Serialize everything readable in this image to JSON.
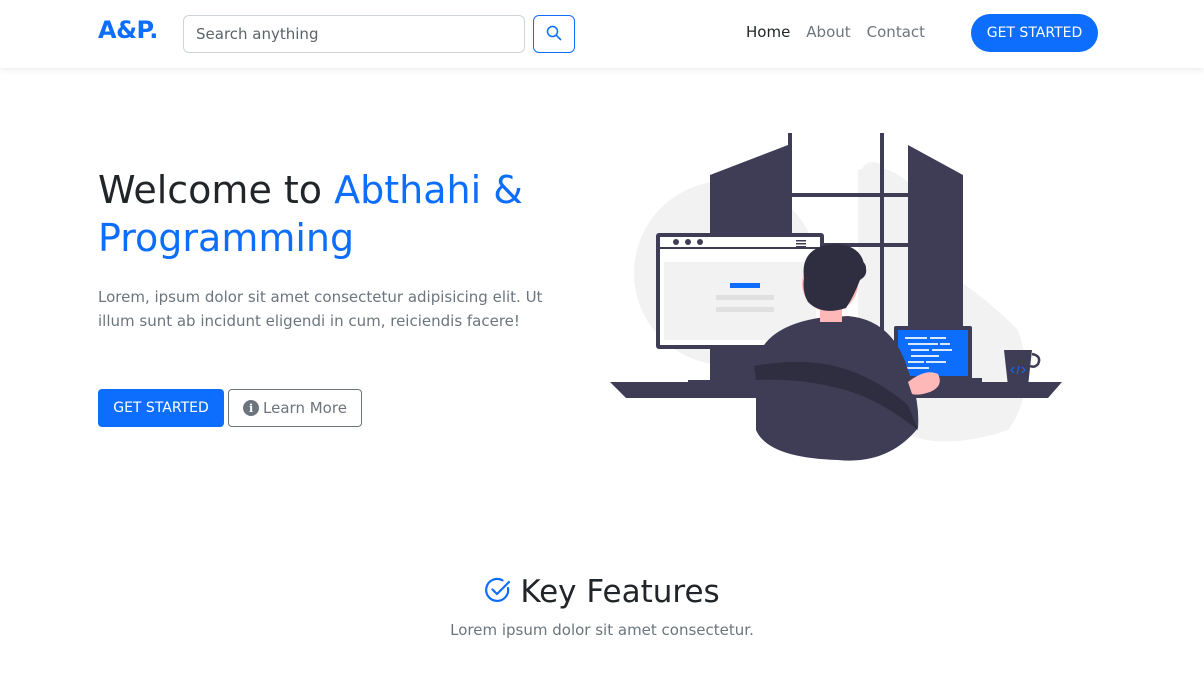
{
  "navbar": {
    "brand": "A&P.",
    "search_placeholder": "Search anything",
    "links": [
      {
        "label": "Home",
        "active": true
      },
      {
        "label": "About",
        "active": false
      },
      {
        "label": "Contact",
        "active": false
      }
    ],
    "cta_label": "GET STARTED"
  },
  "hero": {
    "title_prefix": "Welcome to ",
    "title_accent": "Abthahi & Programming",
    "description": "Lorem, ipsum dolor sit amet consectetur adipisicing elit. Ut illum sunt ab incidunt eligendi in cum, reiciendis facere!",
    "primary_button": "GET STARTED",
    "secondary_button": "Learn More"
  },
  "features": {
    "title": "Key Features",
    "subtitle": "Lorem ipsum dolor sit amet consectetur."
  },
  "colors": {
    "primary": "#0d6efd",
    "text": "#212529",
    "muted": "#6c757d",
    "illustration_dark": "#3f3d56"
  },
  "icons": [
    "search-icon",
    "info-icon",
    "check-circle-icon"
  ]
}
